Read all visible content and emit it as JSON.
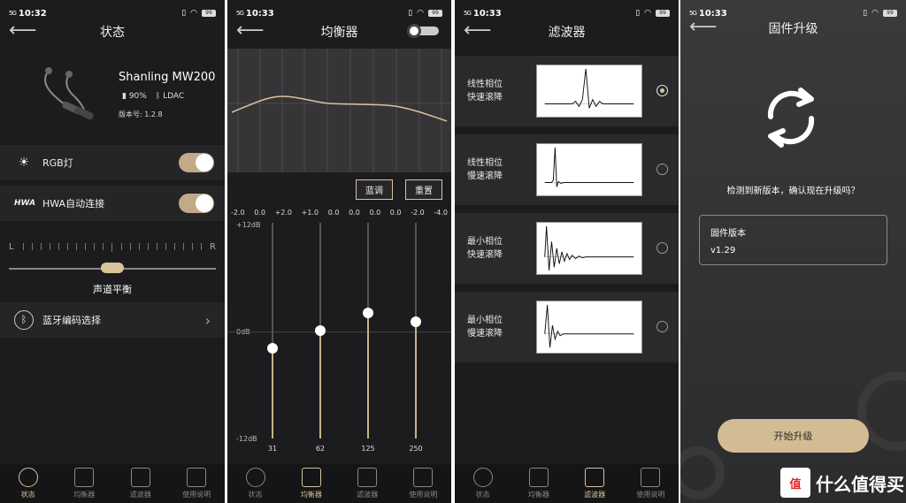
{
  "screens": {
    "status": {
      "statusbar": {
        "signal": "5G",
        "time": "10:32",
        "battery": "99"
      },
      "title": "状态",
      "device": {
        "name": "Shanling MW200",
        "battery": "90%",
        "codec": "LDAC",
        "version": "版本号: 1.2.8"
      },
      "rows": {
        "rgb": "RGB灯",
        "hwa": "HWA自动连接",
        "codec": "蓝牙编码选择"
      },
      "balance": {
        "left": "L",
        "right": "R",
        "title": "声道平衡"
      }
    },
    "eq": {
      "statusbar": {
        "signal": "5G",
        "time": "10:33",
        "battery": "99"
      },
      "title": "均衡器",
      "gains": [
        "-2.0",
        "0.0",
        "+2.0",
        "+1.0",
        "0.0",
        "0.0",
        "0.0",
        "0.0",
        "-2.0",
        "-4.0"
      ],
      "buttons": {
        "preset": "蓝调",
        "reset": "重置"
      },
      "db": {
        "top": "+12dB",
        "mid": "0dB",
        "bottom": "-12dB"
      },
      "sliders": [
        {
          "freq": "31",
          "gain": -2
        },
        {
          "freq": "62",
          "gain": 0
        },
        {
          "freq": "125",
          "gain": 2
        },
        {
          "freq": "250",
          "gain": 1
        }
      ]
    },
    "filter": {
      "statusbar": {
        "signal": "5G",
        "time": "10:33",
        "battery": "99"
      },
      "title": "滤波器",
      "items": [
        {
          "line1": "线性相位",
          "line2": "快速滚降",
          "selected": true
        },
        {
          "line1": "线性相位",
          "line2": "慢速滚降",
          "selected": false
        },
        {
          "line1": "最小相位",
          "line2": "快速滚降",
          "selected": false
        },
        {
          "line1": "最小相位",
          "line2": "慢速滚降",
          "selected": false
        }
      ]
    },
    "firmware": {
      "statusbar": {
        "signal": "5G",
        "time": "10:33",
        "battery": "99"
      },
      "title": "固件升级",
      "question": "检测到新版本，确认现在升级吗？",
      "box_label": "固件版本",
      "version": "v1.29",
      "start": "开始升级"
    }
  },
  "tabs": [
    "状态",
    "均衡器",
    "滤波器",
    "使用说明"
  ],
  "watermark": {
    "text": "什么值得买",
    "icon": "值"
  },
  "colors": {
    "accent": "#d9c39a",
    "bg": "#1c1c1e"
  }
}
